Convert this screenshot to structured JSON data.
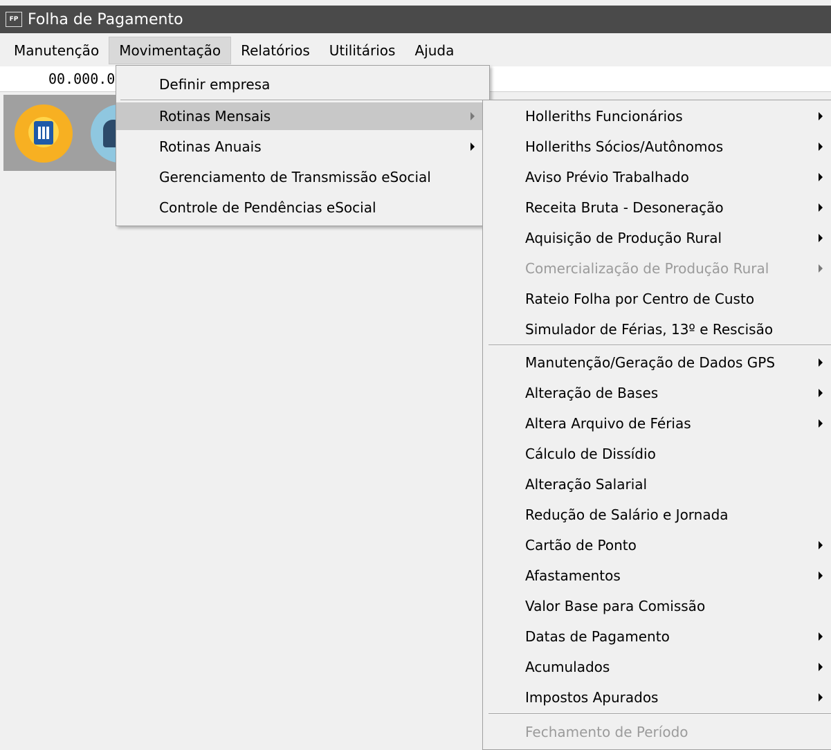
{
  "window": {
    "icon_text": "FP",
    "title": "Folha de Pagamento"
  },
  "menubar": [
    "Manutenção",
    "Movimentação",
    "Relatórios",
    "Utilitários",
    "Ajuda"
  ],
  "company_code": "00.000.0",
  "menu_movimentacao": {
    "items": [
      {
        "label": "Definir empresa"
      },
      {
        "label": "Rotinas Mensais"
      },
      {
        "label": "Rotinas Anuais"
      },
      {
        "label": "Gerenciamento de Transmissão eSocial"
      },
      {
        "label": "Controle de Pendências eSocial"
      }
    ]
  },
  "menu_rotinas_mensais": {
    "items": [
      {
        "label": "Holleriths Funcionários"
      },
      {
        "label": "Holleriths Sócios/Autônomos"
      },
      {
        "label": "Aviso Prévio Trabalhado"
      },
      {
        "label": "Receita Bruta - Desoneração"
      },
      {
        "label": "Aquisição de Produção Rural"
      },
      {
        "label": "Comercialização de Produção Rural"
      },
      {
        "label": "Rateio Folha por Centro de Custo"
      },
      {
        "label": "Simulador de Férias, 13º e Rescisão"
      },
      {
        "label": "Manutenção/Geração de Dados GPS"
      },
      {
        "label": "Alteração de Bases"
      },
      {
        "label": "Altera Arquivo de Férias"
      },
      {
        "label": "Cálculo de Dissídio"
      },
      {
        "label": "Alteração Salarial"
      },
      {
        "label": "Redução de Salário e Jornada"
      },
      {
        "label": "Cartão de Ponto"
      },
      {
        "label": "Afastamentos"
      },
      {
        "label": "Valor Base para Comissão"
      },
      {
        "label": "Datas de Pagamento"
      },
      {
        "label": "Acumulados"
      },
      {
        "label": "Impostos Apurados"
      },
      {
        "label": "Fechamento de Período"
      }
    ]
  }
}
